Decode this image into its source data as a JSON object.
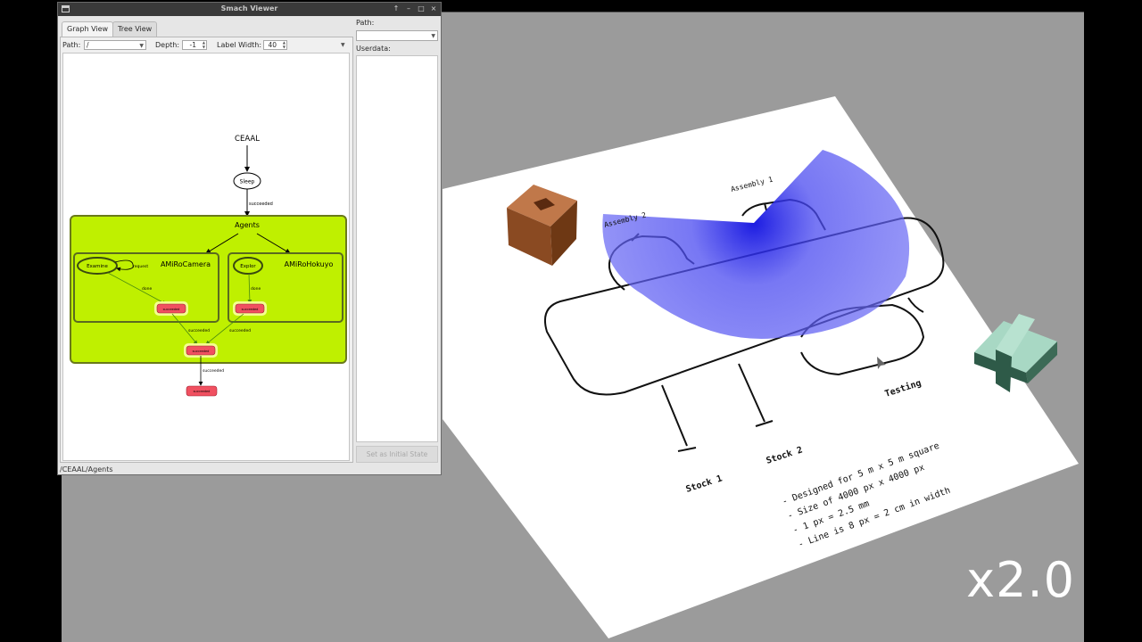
{
  "window": {
    "title": "Smach Viewer",
    "buttons": {
      "pin": "↑",
      "minimize": "–",
      "maximize": "□",
      "close": "×"
    },
    "tabs": [
      {
        "label": "Graph View",
        "active": true
      },
      {
        "label": "Tree View",
        "active": false
      }
    ],
    "toolbar": {
      "path_label": "Path:",
      "path_value": "/",
      "depth_label": "Depth:",
      "depth_value": "-1",
      "label_width_label": "Label Width:",
      "label_width_value": "40"
    },
    "right_panel": {
      "path_label": "Path:",
      "path_value": "",
      "userdata_label": "Userdata:",
      "set_initial_button": "Set as Initial State"
    },
    "status": "/CEAAL/Agents"
  },
  "graph": {
    "root": "CEAAL",
    "sleep": "Sleep",
    "sleep_out": "succeeded",
    "agents": "Agents",
    "camera": "AMiRoCamera",
    "hokuyo": "AMiRoHokuyo",
    "examine": "Examine",
    "examine_loop": "request",
    "explor": "Explor",
    "done_left": "done",
    "done_right": "done",
    "succeeded_outcome": "succeeded",
    "edge_left": "succeeded",
    "edge_right": "succeeded",
    "edge_bottom": "succeeded",
    "colors": {
      "container": "#bff000",
      "container_border": "#6a7a1a",
      "outcome": "#f05060",
      "active_glow": "#f4ff90"
    }
  },
  "scene": {
    "labels": {
      "assembly1": "Assembly 1",
      "assembly2": "Assembly 2",
      "testing": "Testing",
      "stock1": "Stock 1",
      "stock2": "Stock 2"
    },
    "notes": [
      "- Designed for 5 m x 5 m square",
      "- Size of 4000 px x 4000 px",
      "- 1 px = 2.5 mm",
      "- Line is 8 px = 2 cm in width"
    ],
    "playback_speed": "x2.0",
    "colors": {
      "background": "#9b9b9b",
      "sensor": "#3a3af0",
      "cube": "#8a4a22",
      "robot": "#2e5a48"
    }
  }
}
